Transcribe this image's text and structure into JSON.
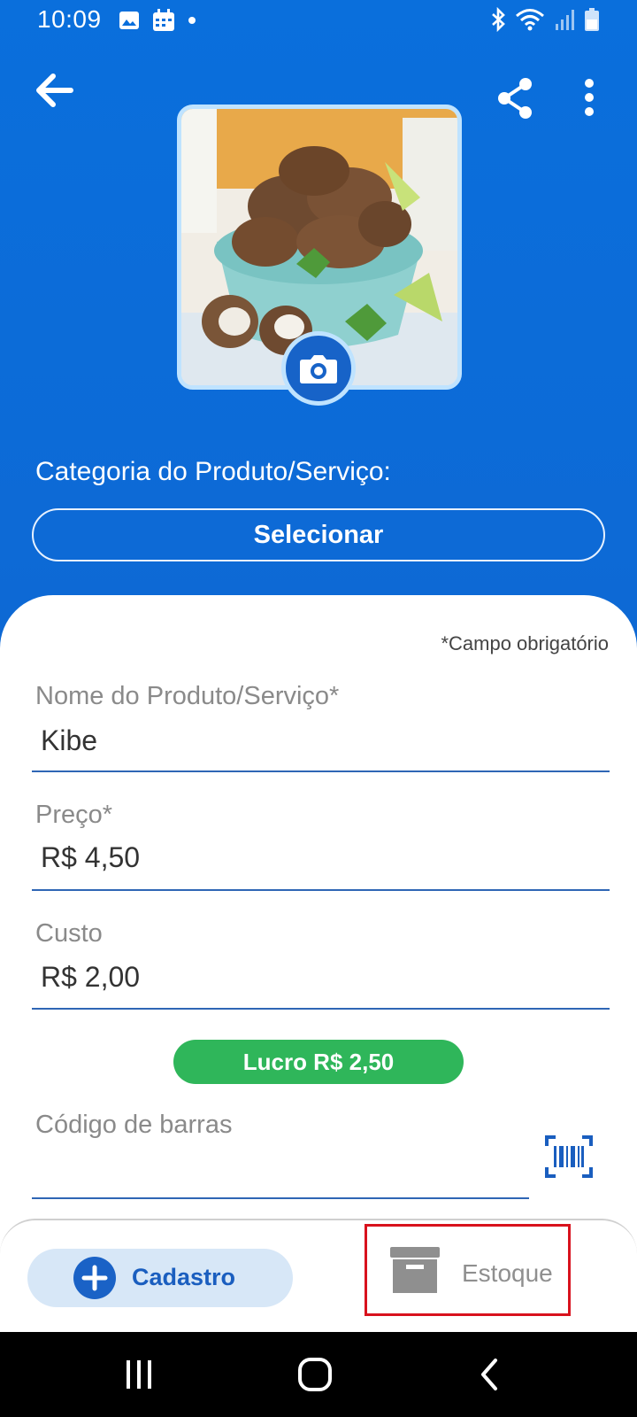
{
  "status_bar": {
    "time": "10:09"
  },
  "header": {
    "back_icon": "arrow-left-icon",
    "share_icon": "share-icon",
    "more_icon": "more-vertical-icon",
    "camera_icon": "camera-icon"
  },
  "category": {
    "label": "Categoria do Produto/Serviço:",
    "button_label": "Selecionar"
  },
  "form": {
    "required_note": "*Campo obrigatório",
    "name_label": "Nome do Produto/Serviço*",
    "name_value": "Kibe",
    "price_label": "Preço*",
    "price_value": "R$ 4,50",
    "cost_label": "Custo",
    "cost_value": "R$ 2,00",
    "profit_label": "Lucro R$ 2,50",
    "barcode_label": "Código de barras",
    "barcode_value": ""
  },
  "bottom_nav": {
    "tabs": [
      {
        "label": "Cadastro",
        "icon": "plus-icon",
        "active": true
      },
      {
        "label": "Estoque",
        "icon": "archive-box-icon",
        "active": false
      }
    ]
  },
  "colors": {
    "primary_blue": "#0a6fdc",
    "profit_green": "#2fb65a",
    "highlight_red": "#d8121d"
  }
}
